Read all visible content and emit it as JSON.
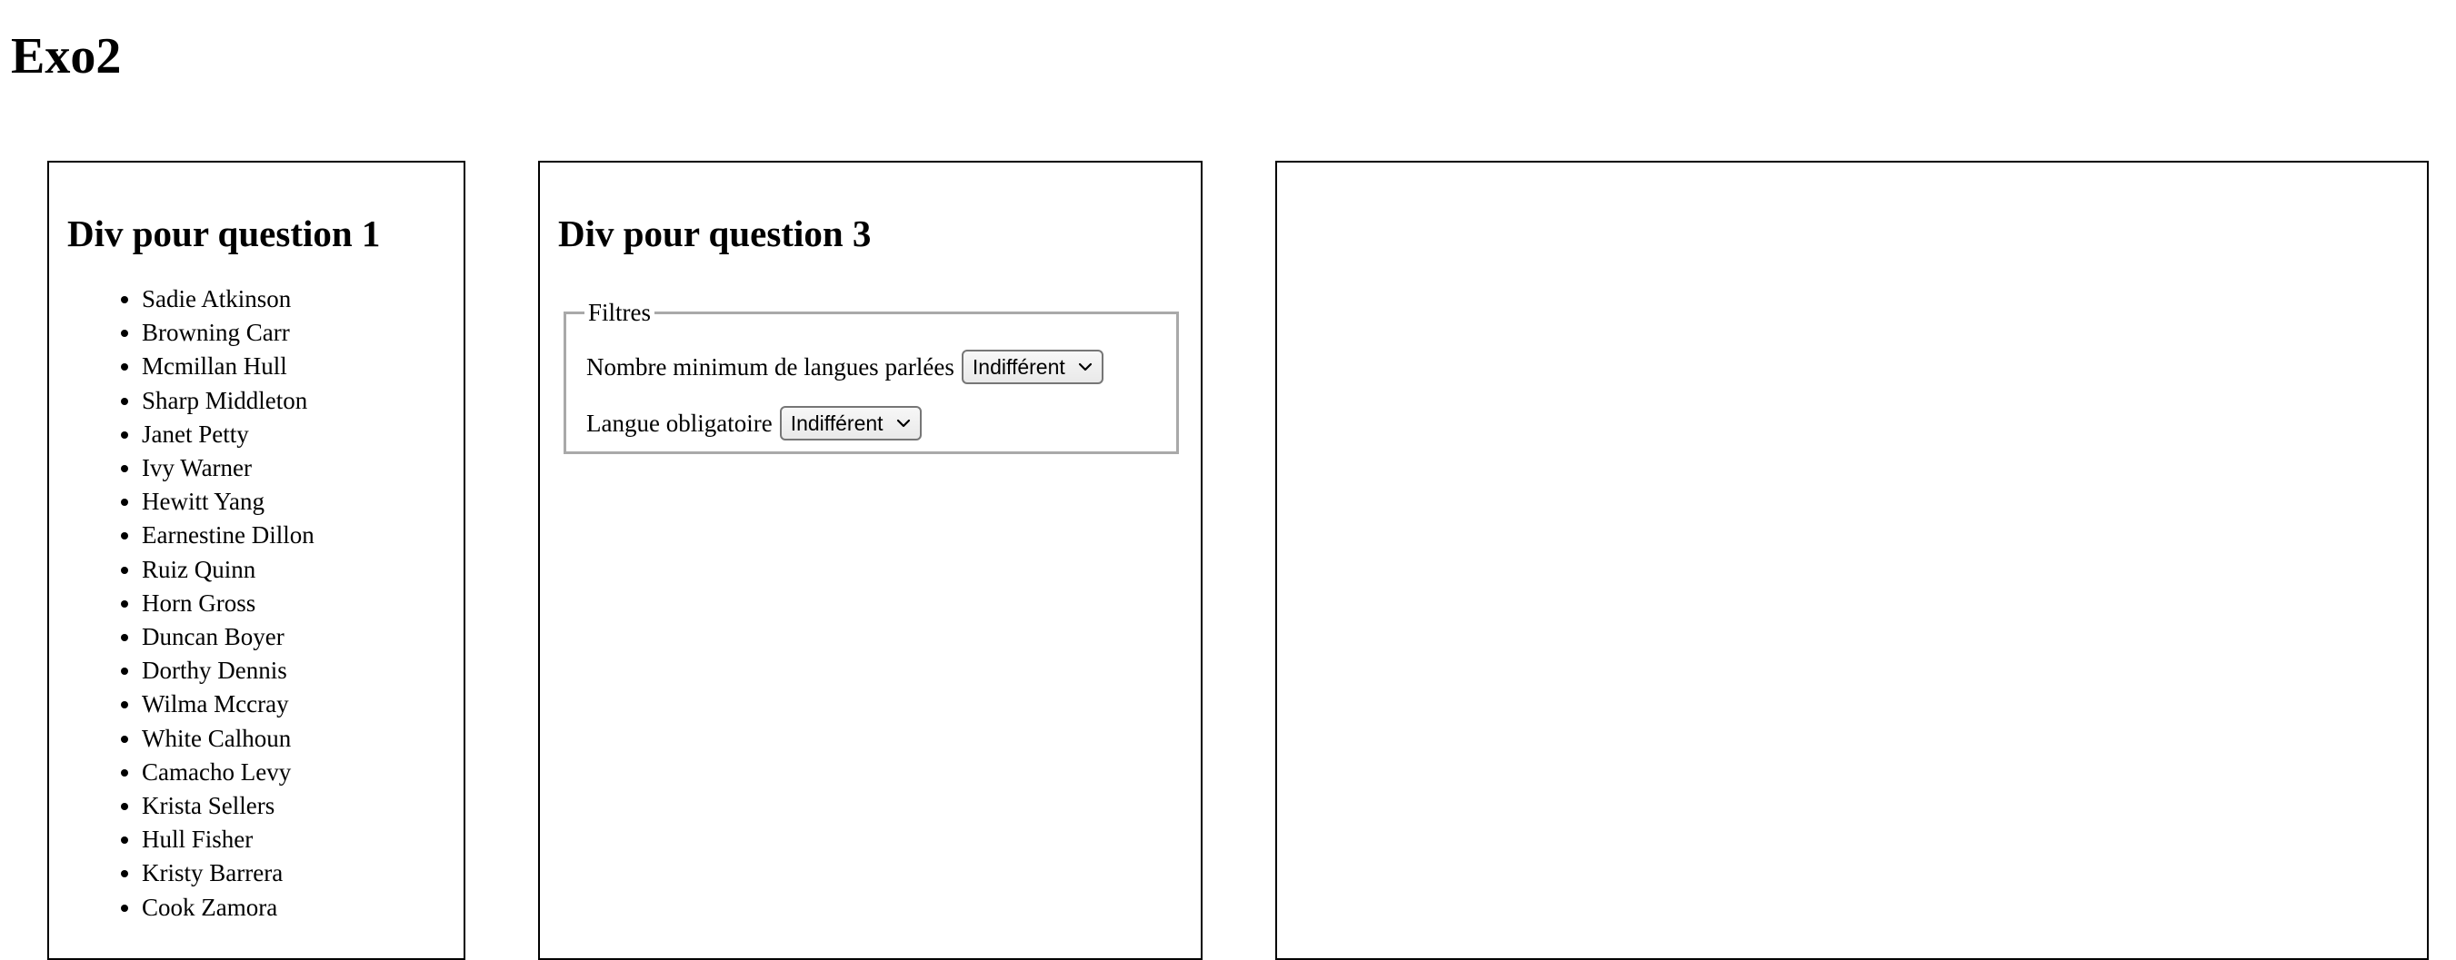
{
  "page": {
    "title": "Exo2"
  },
  "panel_q1": {
    "heading": "Div pour question 1",
    "names": [
      "Sadie Atkinson",
      "Browning Carr",
      "Mcmillan Hull",
      "Sharp Middleton",
      "Janet Petty",
      "Ivy Warner",
      "Hewitt Yang",
      "Earnestine Dillon",
      "Ruiz Quinn",
      "Horn Gross",
      "Duncan Boyer",
      "Dorthy Dennis",
      "Wilma Mccray",
      "White Calhoun",
      "Camacho Levy",
      "Krista Sellers",
      "Hull Fisher",
      "Kristy Barrera",
      "Cook Zamora"
    ]
  },
  "panel_q3": {
    "heading": "Div pour question 3",
    "filters": {
      "legend": "Filtres",
      "min_languages": {
        "label": "Nombre minimum de langues parlées",
        "selected": "Indifférent"
      },
      "required_language": {
        "label": "Langue obligatoire",
        "selected": "Indifférent"
      }
    }
  },
  "icons": {
    "dropdown": "chevron-down-icon"
  }
}
